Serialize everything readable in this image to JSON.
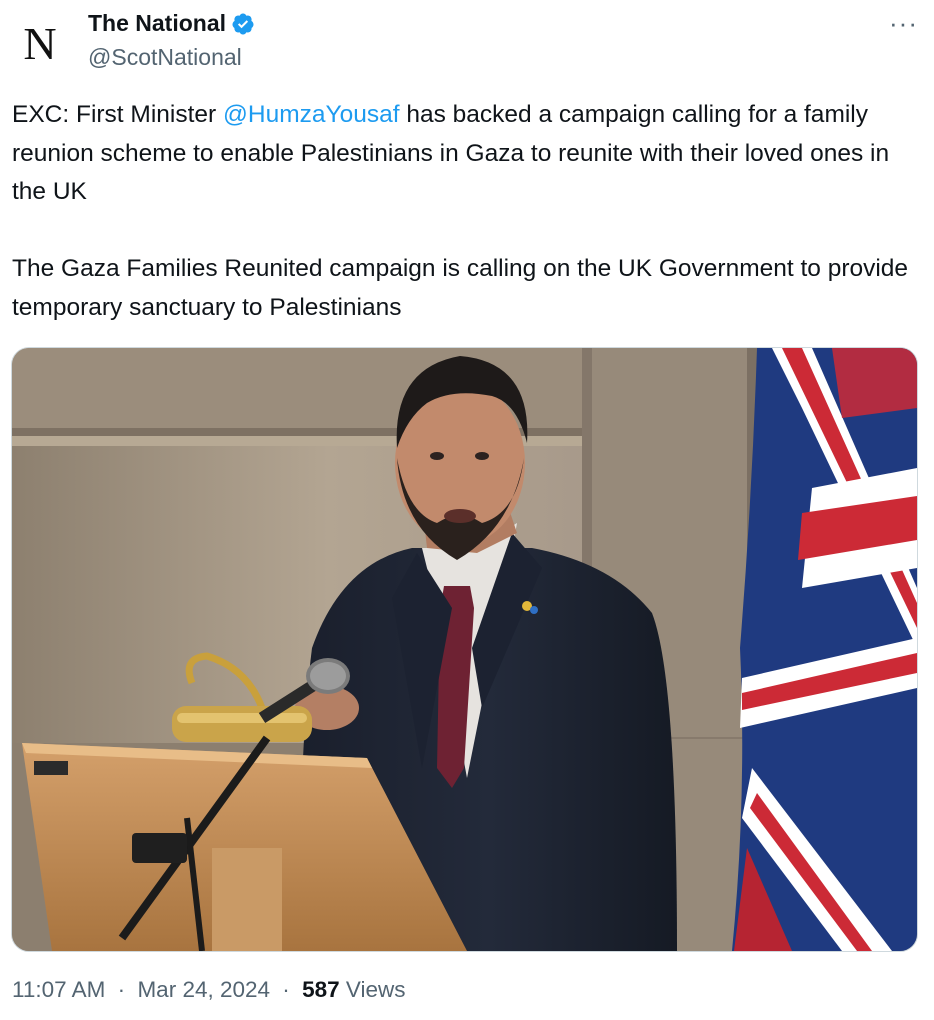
{
  "tweet": {
    "author": {
      "display_name": "The National",
      "handle": "@ScotNational",
      "avatar_letter": "N",
      "verified": true,
      "verified_color": "#1d9bf0"
    },
    "more_label": "···",
    "text": {
      "p1_before": "EXC: First Minister ",
      "p1_mention": "@HumzaYousaf",
      "p1_after": " has backed a campaign calling for a family reunion scheme to enable Palestinians in Gaza to reunite with their loved ones in the UK",
      "p2": "The Gaza Families Reunited campaign is calling on the UK Government to provide temporary sanctuary to Palestinians"
    },
    "mention_color": "#1d9bf0",
    "media": {
      "icon": "photo-icon"
    },
    "meta": {
      "time": "11:07 AM",
      "separator": "·",
      "date": "Mar 24, 2024",
      "views_count": "587",
      "views_label": "Views"
    }
  }
}
